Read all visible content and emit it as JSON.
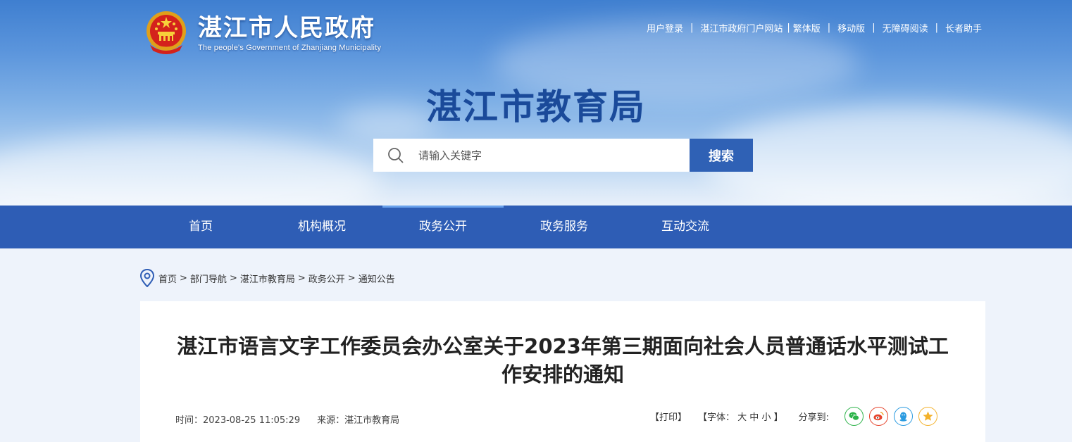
{
  "header": {
    "site_name": "湛江市人民政府",
    "site_name_en": "The people's Government of Zhanjiang Municipality",
    "top_links": [
      "用户登录",
      "湛江市政府门户网站",
      "繁体版",
      "移动版",
      "无障碍阅读",
      "长者助手"
    ],
    "department_title": "湛江市教育局",
    "search": {
      "placeholder": "请输入关键字",
      "button": "搜索"
    }
  },
  "nav": {
    "items": [
      "首页",
      "机构概况",
      "政务公开",
      "政务服务",
      "互动交流"
    ],
    "active_index": 2
  },
  "breadcrumb": [
    "首页",
    "部门导航",
    "湛江市教育局",
    "政务公开",
    "通知公告"
  ],
  "article": {
    "title": "湛江市语言文字工作委员会办公室关于2023年第三期面向社会人员普通话水平测试工作安排的通知",
    "time_label": "时间：",
    "time": "2023-08-25 11:05:29",
    "source_label": "来源：",
    "source": "湛江市教育局",
    "print": "【打印】",
    "font_label": "【字体：",
    "font_sizes": [
      "大",
      "中",
      "小"
    ],
    "font_close": "】",
    "share_label": "分享到:",
    "share_icons": [
      "wechat-icon",
      "weibo-icon",
      "qq-icon",
      "qzone-icon"
    ]
  },
  "colors": {
    "nav_bg": "#2e5db5",
    "title_blue": "#1a4a9a",
    "search_btn": "#2f61b5",
    "wechat": "#2db34a",
    "weibo": "#e6442c",
    "qq": "#2b9be0",
    "qzone": "#f3b12b"
  }
}
